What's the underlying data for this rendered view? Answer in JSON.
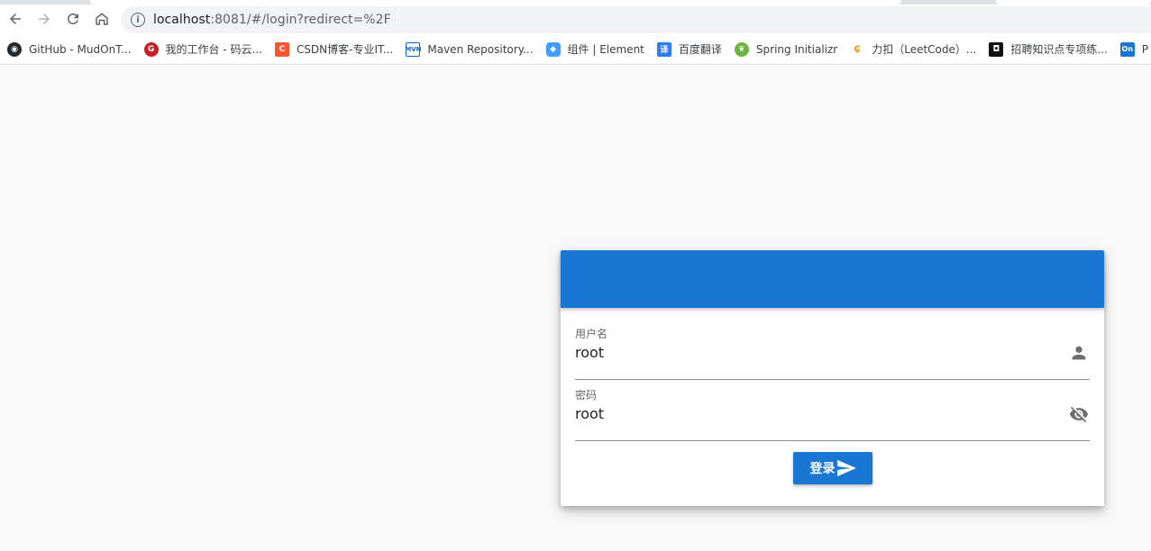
{
  "browser": {
    "url_host": "localhost",
    "url_rest": ":8081/#/login?redirect=%2F",
    "bookmarks": [
      {
        "label": "GitHub - MudOnT...",
        "icon": "github-icon",
        "color": "#24292e"
      },
      {
        "label": "我的工作台 - 码云...",
        "icon": "gitee-icon",
        "color": "#c71d23"
      },
      {
        "label": "CSDN博客-专业IT...",
        "icon": "csdn-icon",
        "color": "#fc5531"
      },
      {
        "label": "Maven Repository...",
        "icon": "maven-icon",
        "color": "#1565c0"
      },
      {
        "label": "组件 | Element",
        "icon": "element-icon",
        "color": "#409eff"
      },
      {
        "label": "百度翻译",
        "icon": "baidu-translate-icon",
        "color": "#2b7cff"
      },
      {
        "label": "Spring Initializr",
        "icon": "spring-icon",
        "color": "#6db33f"
      },
      {
        "label": "力扣（LeetCode）...",
        "icon": "leetcode-icon",
        "color": "#f89f1b"
      },
      {
        "label": "招聘知识点专项练...",
        "icon": "nowcoder-icon",
        "color": "#111111"
      },
      {
        "label": "P",
        "icon": "onenote-icon",
        "color": "#1976d2"
      }
    ]
  },
  "login": {
    "header_color": "#1976d2",
    "username": {
      "label": "用户名",
      "value": "root",
      "icon": "person-icon"
    },
    "password": {
      "label": "密码",
      "value": "root",
      "icon": "eye-off-icon"
    },
    "submit_label": "登录",
    "submit_icon": "send-icon"
  }
}
